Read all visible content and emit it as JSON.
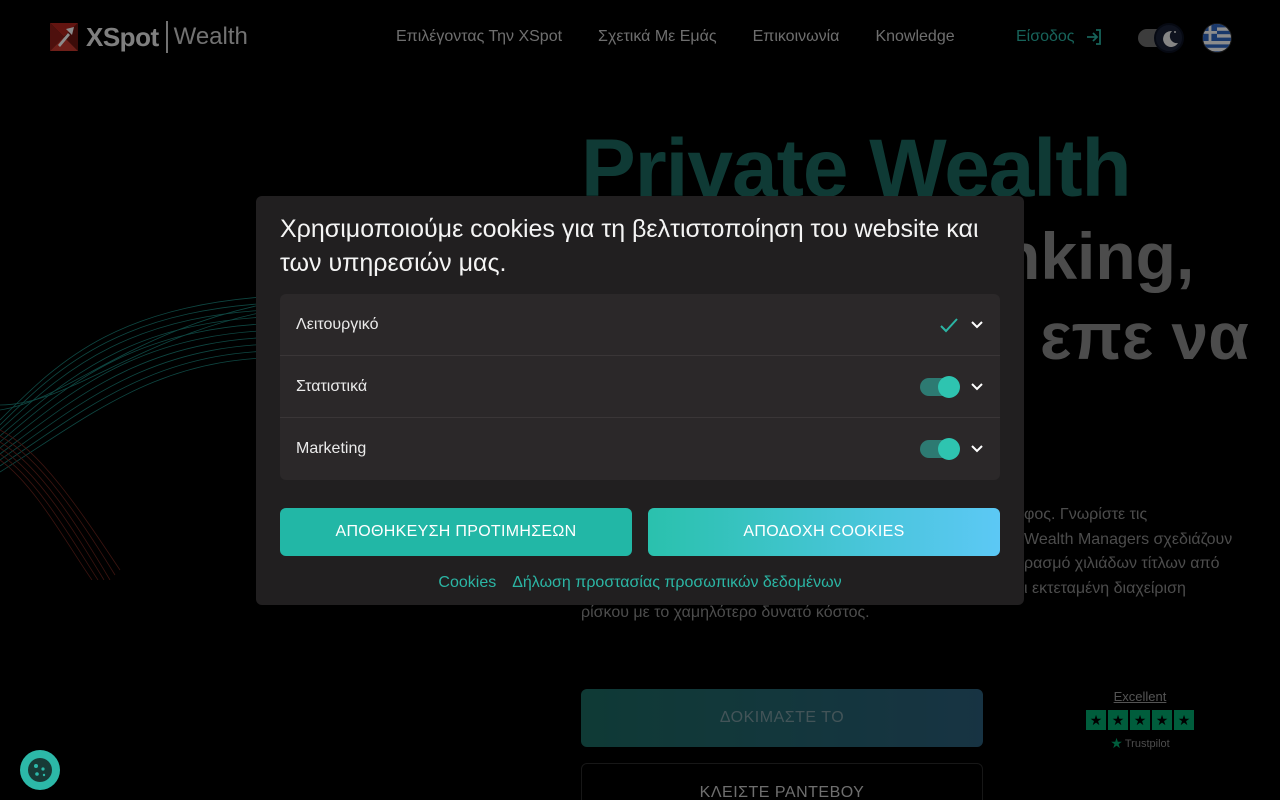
{
  "header": {
    "brand": "XSpot",
    "brand_sub": "Wealth",
    "nav": [
      {
        "label": "Επιλέγοντας Την XSpot"
      },
      {
        "label": "Σχετικά Με Εμάς"
      },
      {
        "label": "Επικοινωνία"
      },
      {
        "label": "Knowledge"
      }
    ],
    "login_label": "Είσοδος"
  },
  "hero": {
    "title_line1": "Private Wealth",
    "title_line2": "nking,",
    "title_line3": "επε να",
    "body_lines": [
      "φος. Γνωρίστε τις",
      "Wealth Managers σχεδιάζουν",
      "ρασμό χιλιάδων τίτλων από",
      "ι εκτεταμένη διαχείριση",
      "ρίσκου με το χαμηλότερο δυνατό κόστος."
    ],
    "try_label": "ΔΟΚΙΜΑΣΤΕ ΤΟ",
    "book_label": "ΚΛΕΙΣΤΕ ΡΑΝΤΕΒΟΥ"
  },
  "trustpilot": {
    "rating_text": "Excellent",
    "stars": 5,
    "brand": "Trustpilot"
  },
  "cookie_modal": {
    "title": "Χρησιμοποιούμε cookies για τη βελτιστοποίηση του website και των υπηρεσιών μας.",
    "preferences": [
      {
        "label": "Λειτουργικό",
        "state": "always-on"
      },
      {
        "label": "Στατιστικά",
        "state": "on"
      },
      {
        "label": "Marketing",
        "state": "on"
      }
    ],
    "save_label": "ΑΠΟΘΗΚΕΥΣΗ ΠΡΟΤΙΜΗΣΕΩΝ",
    "accept_label": "ΑΠΟΔΟΧΗ COOKIES",
    "links": [
      {
        "label": "Cookies"
      },
      {
        "label": "Δήλωση προστασίας προσωπικών δεδομένων"
      }
    ]
  },
  "colors": {
    "accent": "#2bb5a4",
    "background": "#000000",
    "modal": "#211f20"
  }
}
